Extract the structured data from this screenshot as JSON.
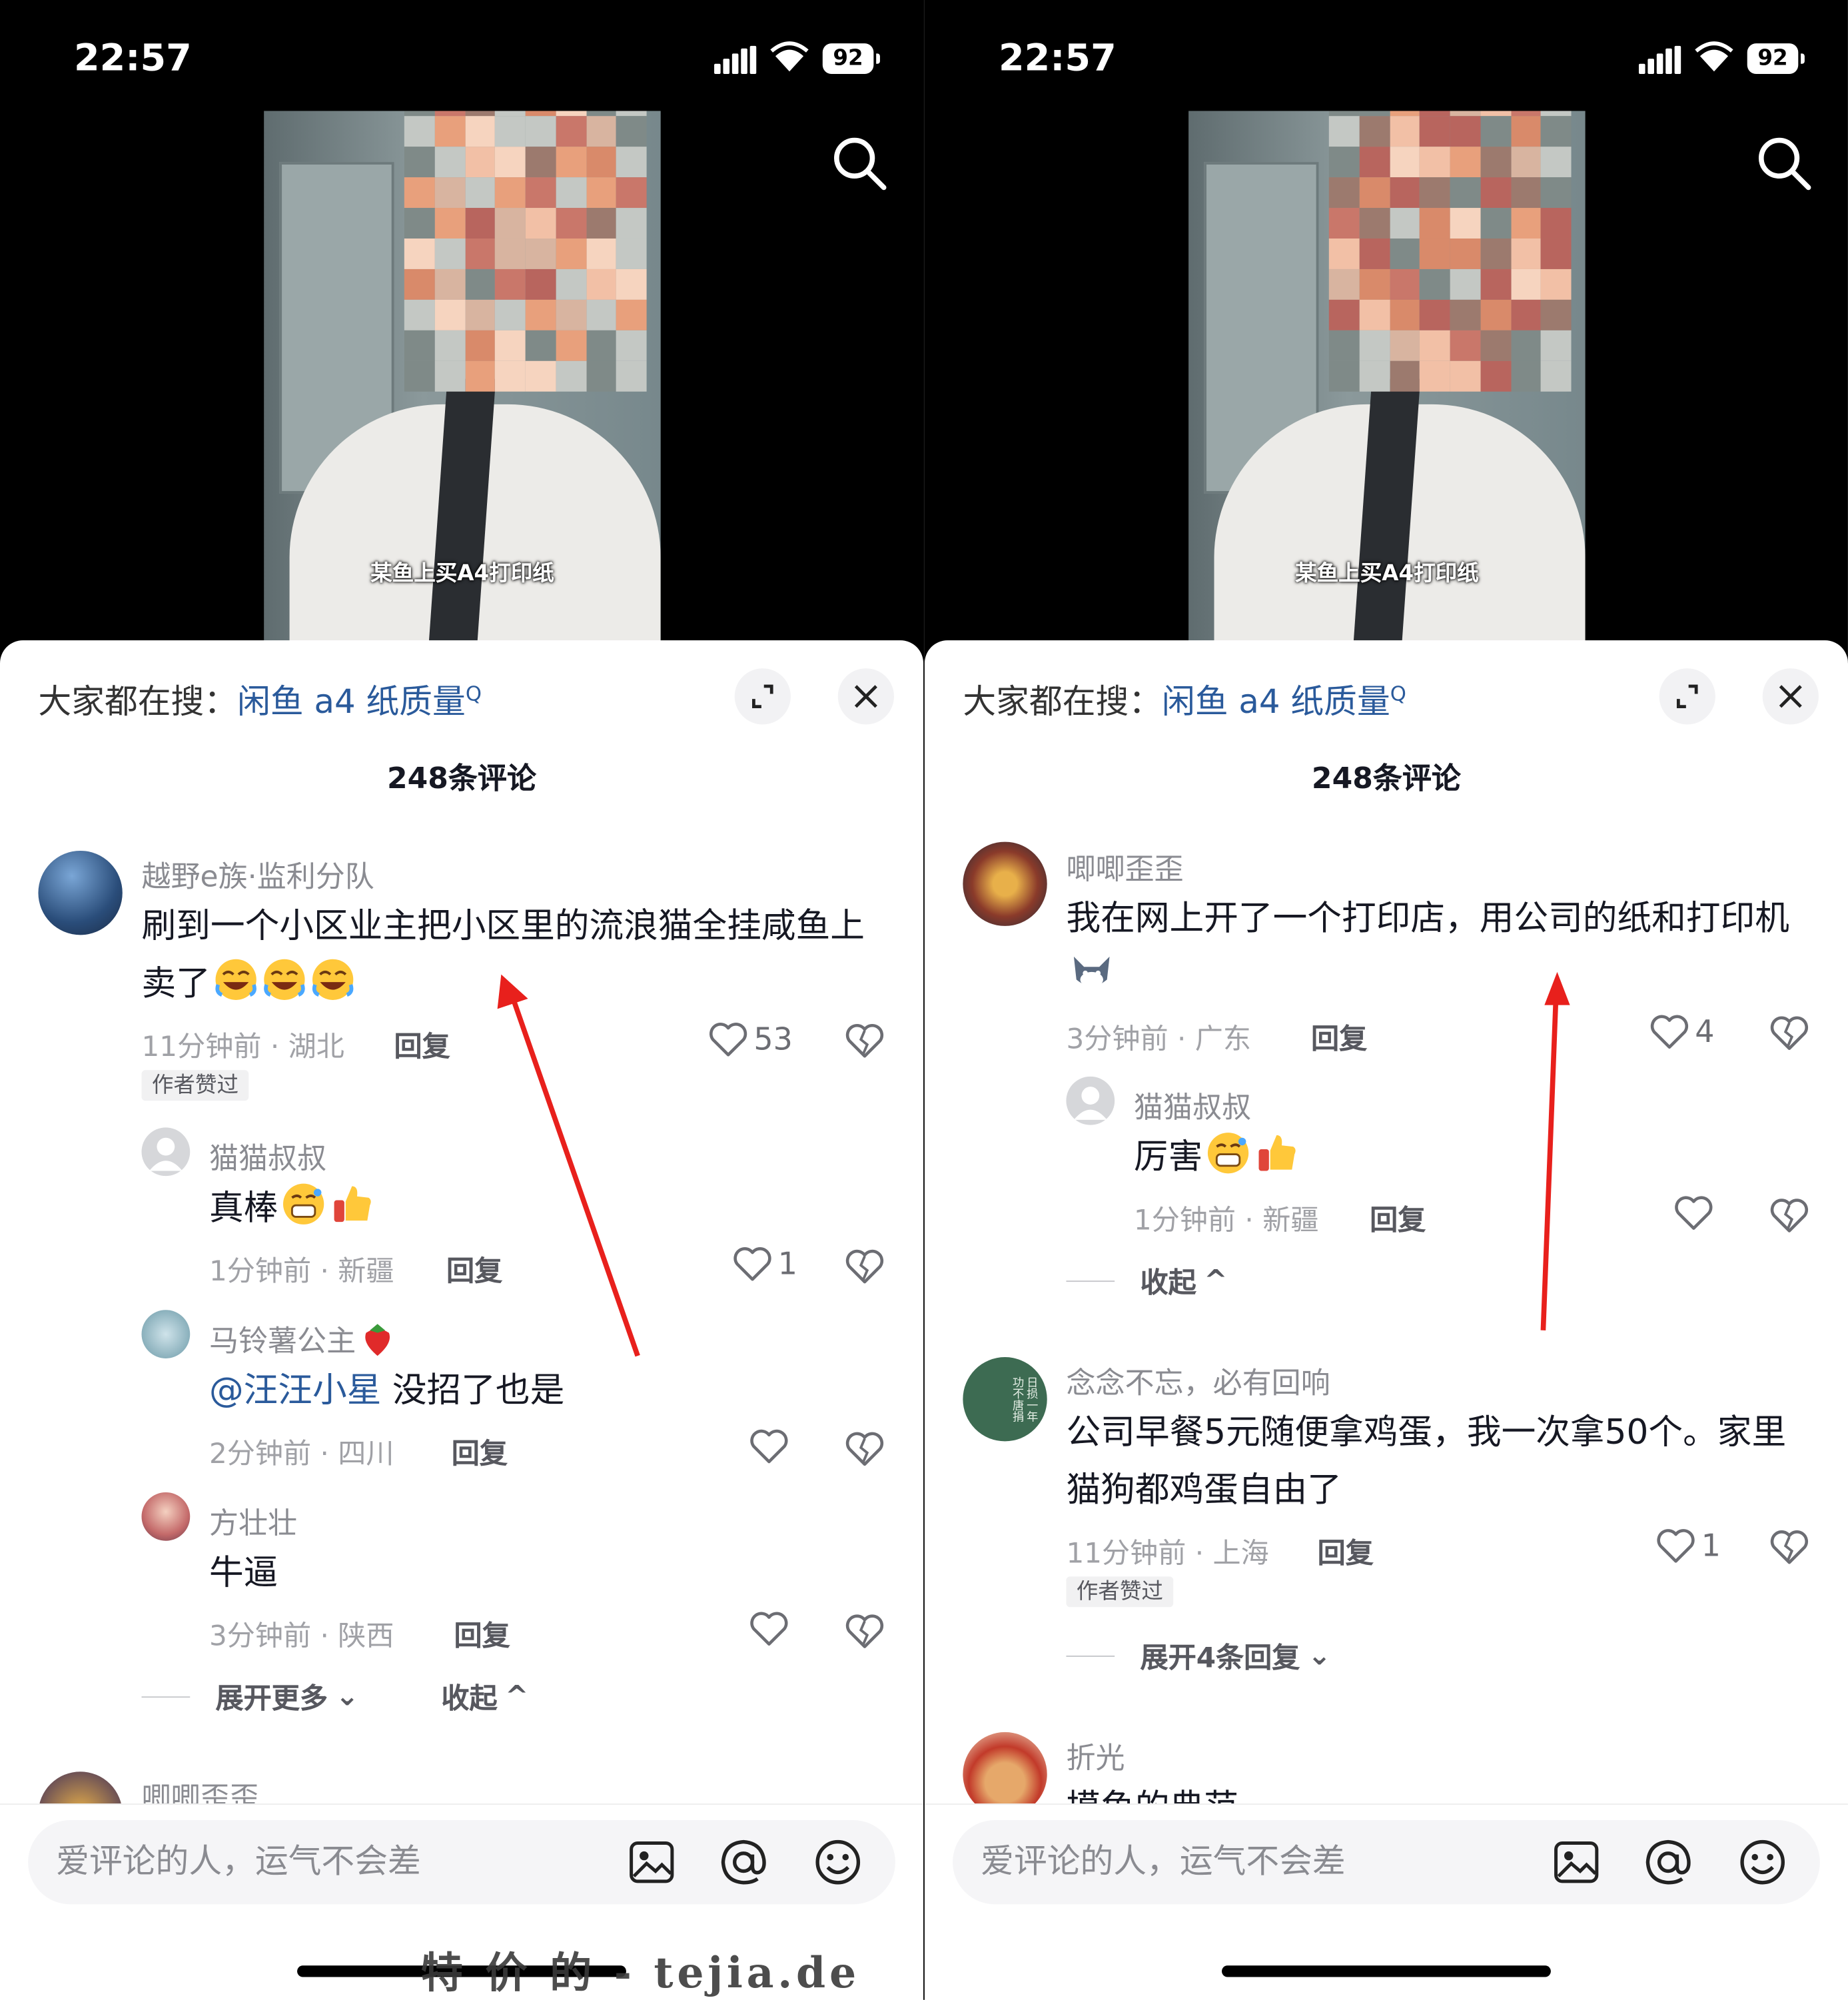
{
  "status": {
    "time": "22:57",
    "battery": "92"
  },
  "video_caption": "某鱼上买A4打印纸",
  "search_hint": {
    "prefix": "大家都在搜：",
    "keyword": "闲鱼 a4 纸质量"
  },
  "comment_count": "248条评论",
  "input_placeholder": "爱评论的人，运气不会差",
  "reply_label": "回复",
  "author_liked": "作者赞过",
  "left": {
    "c1": {
      "user": "越野e族·监利分队",
      "text": "刷到一个小区业主把小区里的流浪猫全挂咸鱼上卖了",
      "meta": "11分钟前 · 湖北",
      "likes": "53"
    },
    "r1": {
      "user": "猫猫叔叔",
      "text": "真棒",
      "meta": "1分钟前 · 新疆",
      "likes": "1"
    },
    "r2": {
      "user": "马铃薯公主",
      "mention": "@汪汪小星",
      "text": " 没招了也是",
      "meta": "2分钟前 · 四川"
    },
    "r3": {
      "user": "方壮壮",
      "text": "牛逼",
      "meta": "3分钟前 · 陕西"
    },
    "expand_more": "展开更多",
    "collapse": "收起",
    "next_user": "唧唧歪歪"
  },
  "right": {
    "c1": {
      "user": "唧唧歪歪",
      "text": "我在网上开了一个打印店，用公司的纸和打印机",
      "meta": "3分钟前 · 广东",
      "likes": "4"
    },
    "r1": {
      "user": "猫猫叔叔",
      "text": "厉害",
      "meta": "1分钟前 · 新疆"
    },
    "collapse": "收起",
    "c2": {
      "user": "念念不忘，必有回响",
      "text": "公司早餐5元随便拿鸡蛋，我一次拿50个。家里猫狗都鸡蛋自由了",
      "meta": "11分钟前 · 上海",
      "likes": "1",
      "avatar_text": "日损一年 功不唐捐"
    },
    "expand_replies": "展开4条回复",
    "c3": {
      "user": "折光",
      "text": "摸鱼的典范"
    }
  },
  "watermark": "特 价 的 - tejia.de",
  "colors": {
    "link": "#2a5a9b",
    "arrow": "#e8201c"
  }
}
